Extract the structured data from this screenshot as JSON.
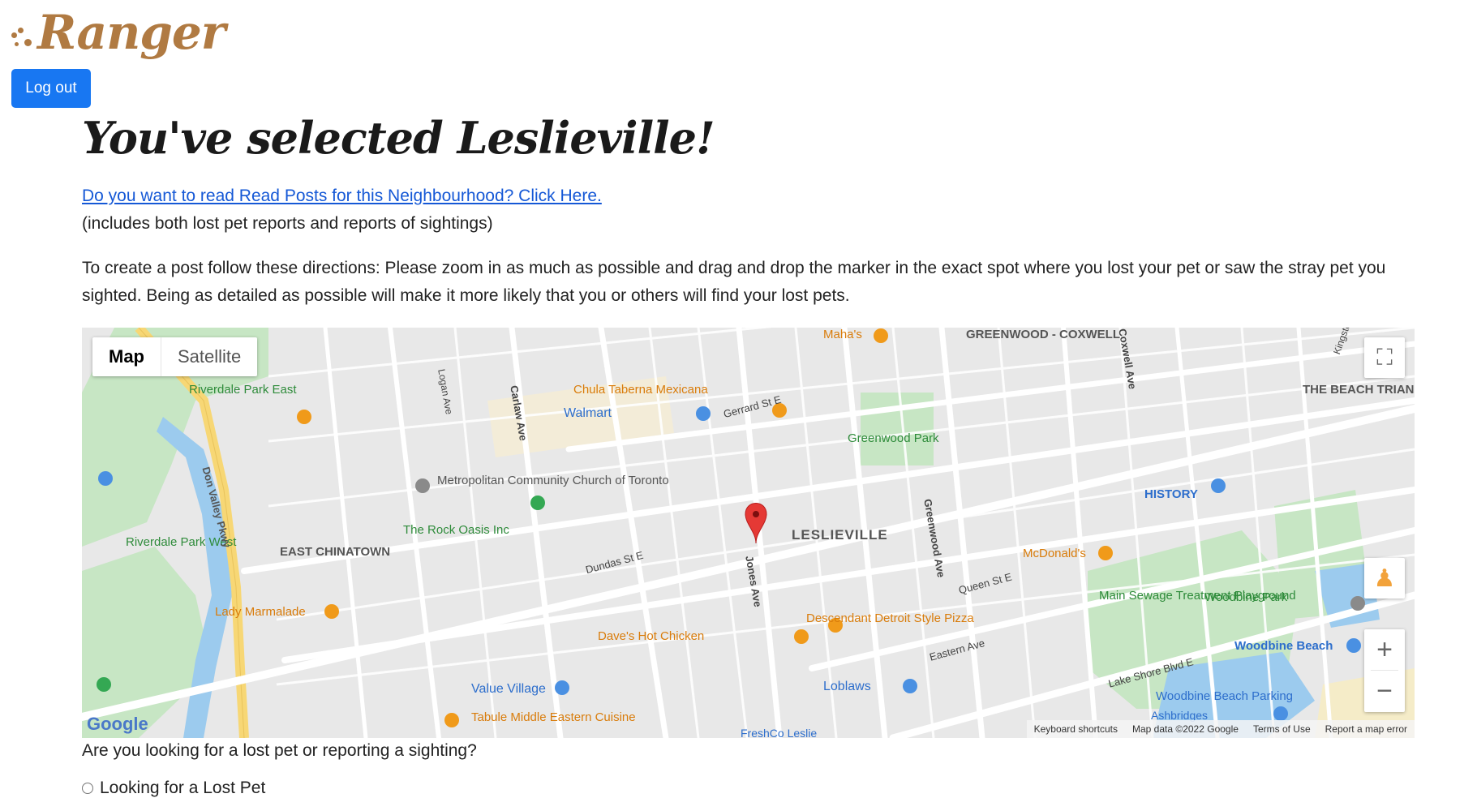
{
  "header": {
    "brand": "Ranger",
    "logout_label": "Log out"
  },
  "main": {
    "title": "You've selected Leslieville!",
    "posts_link": "Do you want to read Read Posts for this Neighbourhood? Click Here.",
    "posts_note": "(includes both lost pet reports and reports of sightings)",
    "directions": "To create a post follow these directions: Please zoom in as much as possible and drag and drop the marker in the exact spot where you lost your pet or saw the stray pet you sighted. Being as detailed as possible will make it more likely that you or others will find your lost pets.",
    "question": "Are you looking for a lost pet or reporting a sighting?",
    "options": [
      {
        "label": "Looking for a Lost Pet"
      }
    ]
  },
  "map": {
    "type_controls": [
      "Map",
      "Satellite"
    ],
    "zoom_in": "+",
    "zoom_out": "−",
    "fullscreen_icon": "⛶",
    "pegman_icon": "♟",
    "google_logo": "Google",
    "attribution": [
      "Keyboard shortcuts",
      "Map data ©2022 Google",
      "Terms of Use",
      "Report a map error"
    ],
    "neighbourhood_label": "LESLIEVILLE",
    "area_labels": [
      "GREENWOOD - COXWELL",
      "THE BEACH TRIANGLE",
      "EAST CHINATOWN"
    ],
    "places": [
      "Maha's",
      "Chula Taberna Mexicana",
      "Walmart",
      "Riverdale Park East",
      "Metropolitan Community Church of Toronto",
      "The Rock Oasis Inc",
      "Greenwood Park",
      "HISTORY",
      "McDonald's",
      "Riverdale Park West",
      "Lady Marmalade",
      "Dave's Hot Chicken",
      "Descendant Detroit Style Pizza",
      "Main Sewage Treatment Playground",
      "Woodbine Park",
      "Woodbine Beach",
      "Value Village",
      "Loblaws",
      "Tabule Middle Eastern Cuisine",
      "Woodbine Beach Parking",
      "FreshCo Leslie",
      "Ashbridges"
    ],
    "streets": [
      "Gerrard St E",
      "Dundas St E",
      "Queen St E",
      "Eastern Ave",
      "Lake Shore Blvd E",
      "Don Valley Pkwy",
      "Carlaw Ave",
      "Jones Ave",
      "Greenwood Ave",
      "Logan Ave",
      "Coxwell Ave",
      "Kingston Rd"
    ],
    "colors": {
      "background": "#e8e8e8",
      "road": "#ffffff",
      "highway": "#f7d775",
      "park": "#c7e6c4",
      "water": "#9ccbee",
      "marker": "#e53935",
      "poi_food": "#f09a1a",
      "poi_shop": "#4a90e2",
      "poi_park": "#34a853"
    }
  }
}
